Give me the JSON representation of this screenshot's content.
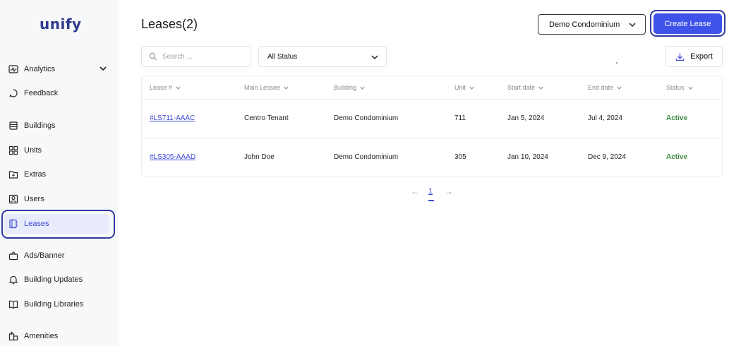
{
  "brand": {
    "logo": "unify"
  },
  "sidebar": {
    "items": [
      {
        "label": "Analytics",
        "icon": "analytics-icon"
      },
      {
        "label": "Feedback",
        "icon": "feedback-icon"
      },
      {
        "label": "Buildings",
        "icon": "buildings-icon"
      },
      {
        "label": "Units",
        "icon": "units-icon"
      },
      {
        "label": "Extras",
        "icon": "extras-icon"
      },
      {
        "label": "Users",
        "icon": "users-icon"
      },
      {
        "label": "Leases",
        "icon": "leases-icon",
        "active": true
      },
      {
        "label": "Ads/Banner",
        "icon": "ads-icon"
      },
      {
        "label": "Building Updates",
        "icon": "bell-icon"
      },
      {
        "label": "Building Libraries",
        "icon": "book-icon"
      },
      {
        "label": "Amenities",
        "icon": "amenities-icon"
      }
    ]
  },
  "header": {
    "title": "Leases(2)",
    "building_select": "Demo Condominium",
    "create_label": "Create Lease"
  },
  "filters": {
    "search_placeholder": "Search ...",
    "status_select": "All Status",
    "export_label": "Export"
  },
  "table": {
    "columns": [
      "Lease #",
      "Main Lessee",
      "Building",
      "Unit",
      "Start date",
      "End date",
      "Status"
    ],
    "rows": [
      {
        "lease": "#LS711-AAAC",
        "lessee": "Centro Tenant",
        "building": "Demo Condominium",
        "unit": "711",
        "start": "Jan 5, 2024",
        "end": "Jul 4, 2024",
        "status": "Active"
      },
      {
        "lease": "#LS305-AAAD",
        "lessee": "John Doe",
        "building": "Demo Condominium",
        "unit": "305",
        "start": "Jan 10, 2024",
        "end": "Dec 9, 2024",
        "status": "Active"
      }
    ]
  },
  "pagination": {
    "prev": "←",
    "page": "1",
    "next": "→"
  },
  "colors": {
    "accent": "#3f52ea",
    "active_status": "#3b8a3e",
    "link": "#3d4bd6",
    "sidebar_bg": "#f7f8fa"
  }
}
